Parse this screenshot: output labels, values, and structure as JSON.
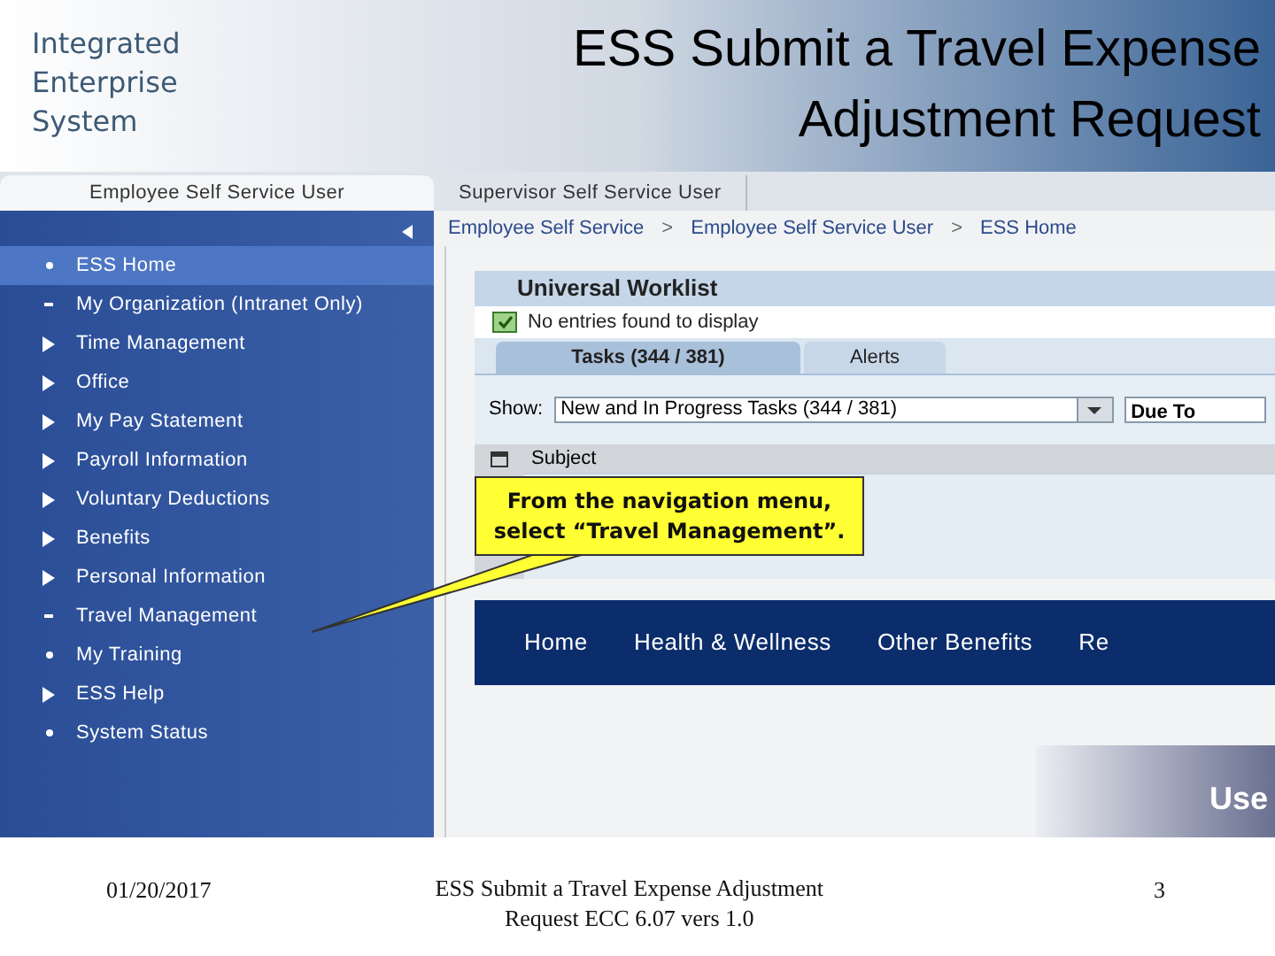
{
  "header": {
    "logo_lines": [
      "Integrated",
      "Enterprise",
      "System"
    ],
    "title_lines": [
      "ESS Submit a Travel Expense",
      "Adjustment Request"
    ]
  },
  "portal_tabs": [
    {
      "label": "Employee Self Service User",
      "selected": true
    },
    {
      "label": "Supervisor Self Service User",
      "selected": false
    }
  ],
  "sidebar": {
    "items": [
      {
        "label": "ESS Home",
        "kind": "bullet",
        "selected": true
      },
      {
        "label": "My Organization (Intranet Only)",
        "kind": "dash",
        "selected": false
      },
      {
        "label": "Time Management",
        "kind": "arrow",
        "selected": false
      },
      {
        "label": "Office",
        "kind": "arrow",
        "selected": false
      },
      {
        "label": "My Pay Statement",
        "kind": "arrow",
        "selected": false
      },
      {
        "label": "Payroll Information",
        "kind": "arrow",
        "selected": false
      },
      {
        "label": "Voluntary Deductions",
        "kind": "arrow",
        "selected": false
      },
      {
        "label": "Benefits",
        "kind": "arrow",
        "selected": false
      },
      {
        "label": "Personal Information",
        "kind": "arrow",
        "selected": false
      },
      {
        "label": "Travel Management",
        "kind": "dash",
        "selected": false
      },
      {
        "label": "My Training",
        "kind": "bullet",
        "selected": false
      },
      {
        "label": "ESS Help",
        "kind": "arrow",
        "selected": false
      },
      {
        "label": "System Status",
        "kind": "bullet",
        "selected": false
      }
    ]
  },
  "breadcrumb": [
    "Employee Self Service",
    "Employee Self Service User",
    "ESS Home"
  ],
  "breadcrumb_separator": ">",
  "worklist": {
    "title": "Universal Worklist",
    "message": "No entries found to display",
    "tabs": [
      {
        "label": "Tasks (344 / 381)",
        "selected": true
      },
      {
        "label": "Alerts",
        "selected": false
      }
    ],
    "show_label": "Show:",
    "show_value": "New and In Progress Tasks (344 / 381)",
    "column_2_value": "Due To",
    "column_header": "Subject"
  },
  "nav_bar": [
    "Home",
    "Health & Wellness",
    "Other Benefits",
    "Re"
  ],
  "banner_text": "Use",
  "callout": "From the navigation menu, select “Travel Management”.",
  "footer": {
    "date": "01/20/2017",
    "caption_lines": [
      "ESS Submit a Travel Expense Adjustment",
      "Request ECC 6.07 vers 1.0"
    ],
    "page": "3"
  }
}
